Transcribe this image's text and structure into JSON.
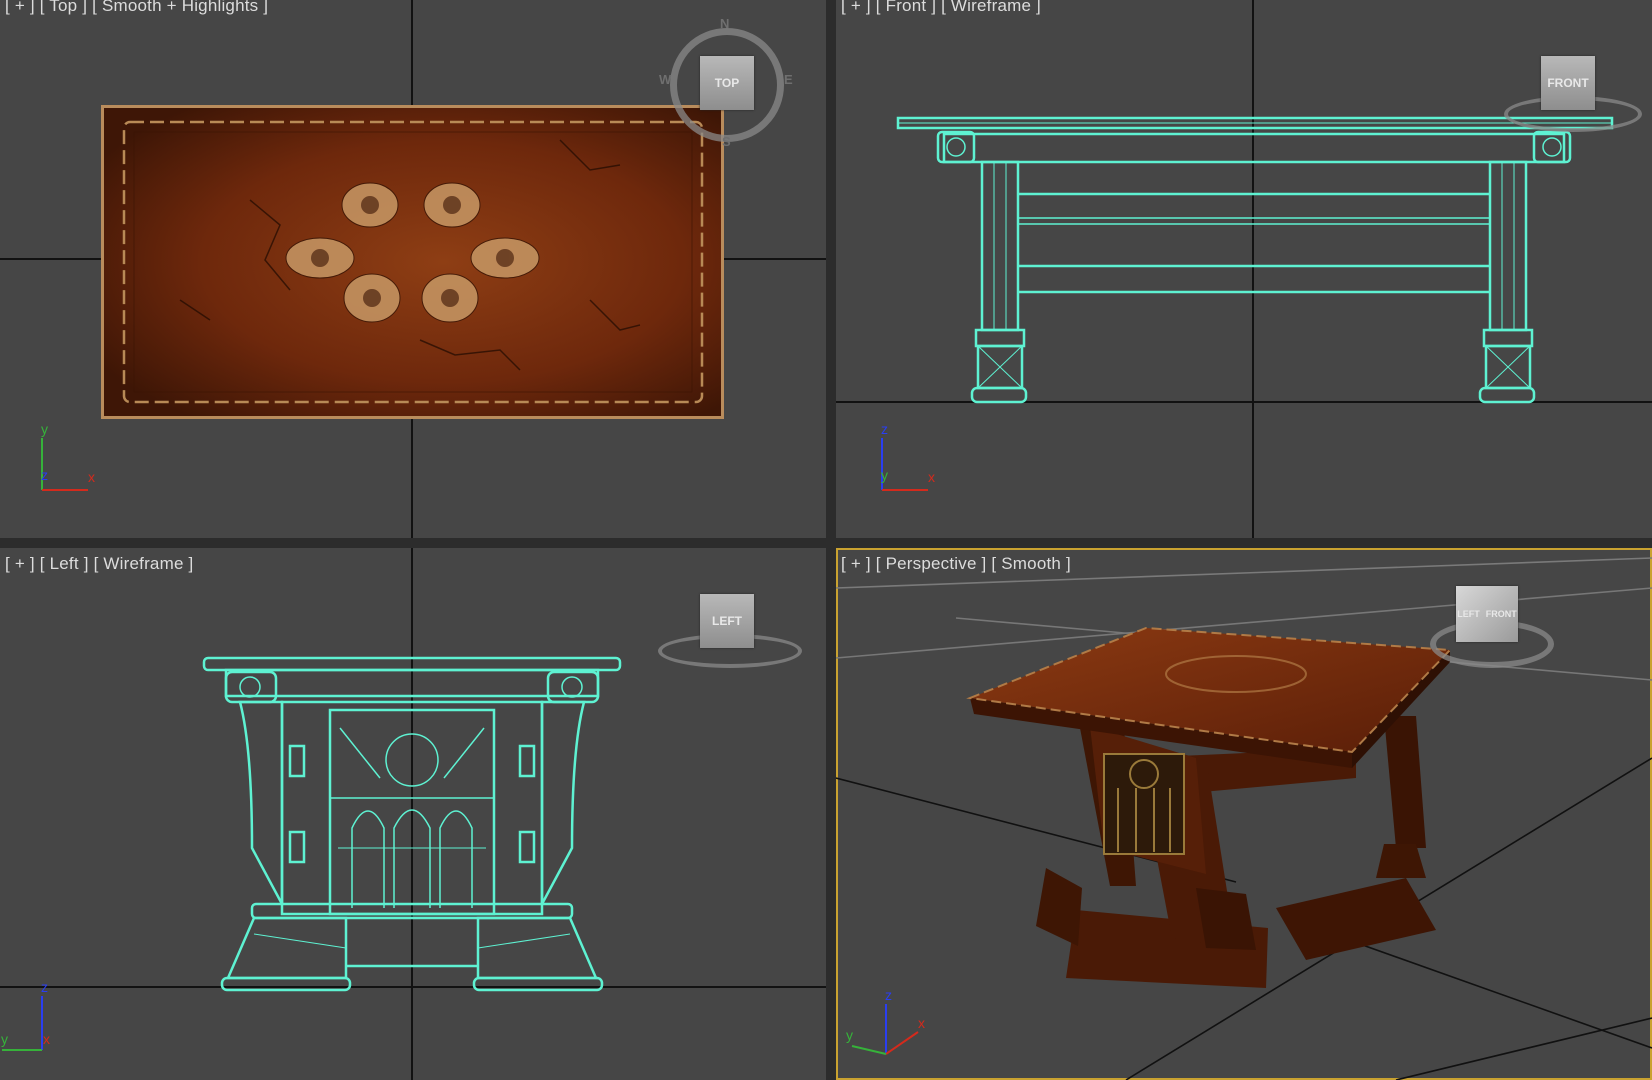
{
  "viewports": {
    "top": {
      "label": {
        "plus": "[ + ]",
        "view": "[ Top ]",
        "shading": "[ Smooth + Highlights ]"
      },
      "viewcube": "TOP",
      "compass": {
        "n": "N",
        "w": "W",
        "e": "E",
        "s": "S"
      },
      "axes": {
        "a": "y",
        "b": "z",
        "c": "x"
      }
    },
    "front": {
      "label": {
        "plus": "[ + ]",
        "view": "[ Front ]",
        "shading": "[ Wireframe ]"
      },
      "viewcube": "FRONT",
      "axes": {
        "a": "z",
        "b": "y",
        "c": "x"
      }
    },
    "left": {
      "label": {
        "plus": "[ + ]",
        "view": "[ Left ]",
        "shading": "[ Wireframe ]"
      },
      "viewcube": "LEFT",
      "axes": {
        "a": "z",
        "b": "y",
        "c": "x"
      }
    },
    "perspective": {
      "label": {
        "plus": "[ + ]",
        "view": "[ Perspective ]",
        "shading": "[ Smooth ]"
      },
      "viewcube": {
        "left": "LEFT",
        "front": "FRONT"
      },
      "axes": {
        "a": "z",
        "b": "y",
        "c": "x"
      }
    }
  },
  "colors": {
    "viewport_bg": "#464646",
    "wireframe": "#5ef2d2",
    "active_border": "#c9a230",
    "wood": "#7a2f10",
    "axis_x": "#d42a1c",
    "axis_y": "#36b23a",
    "axis_z": "#2a3ef0"
  }
}
